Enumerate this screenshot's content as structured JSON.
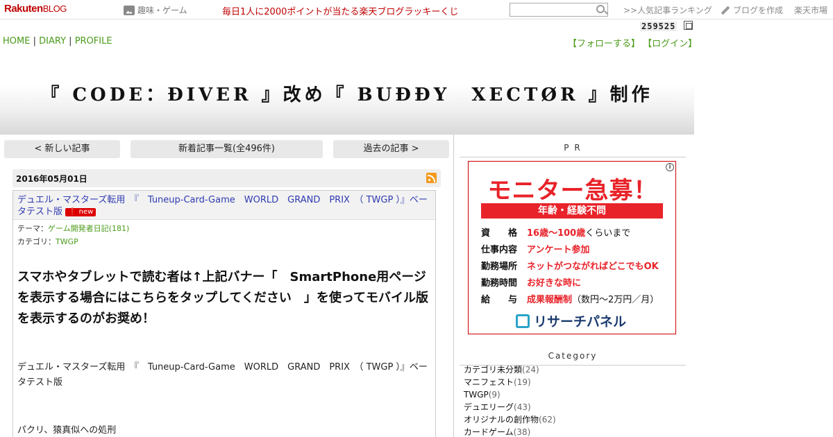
{
  "topbar": {
    "logo_main": "Rakuten",
    "logo_sub": "BLOG",
    "category": "趣味・ゲーム",
    "lottery": "毎日1人に2000ポイントが当たる楽天ブログラッキーくじ",
    "search_value": "",
    "ranking": ">>人気記事ランキング",
    "write": "ブログを作成",
    "market": "楽天市場"
  },
  "counter": "259525",
  "nav": {
    "home": "HOME",
    "diary": "DIARY",
    "profile": "PROFILE",
    "sep": "|",
    "follow": "【フォローする】",
    "login": "【ログイン】"
  },
  "banner": {
    "title": "『 CODE：ĐIVER 』改め『 BUĐĐY　XECTØR 』制作"
  },
  "pager": {
    "newer": "< 新しい記事",
    "list": "新着記事一覧(全496件)",
    "older": "過去の記事 >"
  },
  "post": {
    "date": "2016年05月01日",
    "title": "デュエル・マスターズ転用　『　Tuneup-Card-Game　WORLD　GRAND　PRIX　（ TWGP ）』ベータテスト版",
    "new_badge": "new",
    "theme_label": "テーマ：",
    "theme": "ゲーム開発者日記(181)",
    "category_label": "カテゴリ：",
    "category": "TWGP",
    "lead": "スマホやタブレットで読む者は↑上記バナー「　SmartPhone用ページを表示する場合にはこちらをタップしてください　」を使ってモバイル版を表示するのがお奨め！",
    "body1": "デュエル・マスターズ転用　『　Tuneup-Card-Game　WORLD　GRAND　PRIX　（ TWGP ）』ベータテスト版",
    "body2": "パクリ、猿真似への処刑"
  },
  "sidebar": {
    "pr_heading": "P R",
    "ad": {
      "headline": "モニター急募！",
      "bar": "年齢・経験不問",
      "rows": [
        {
          "label": "資　　格",
          "value": "16歳～100歳",
          "tail": "くらいまで"
        },
        {
          "label": "仕事内容",
          "value": "アンケート参加",
          "tail": ""
        },
        {
          "label": "勤務場所",
          "value": "ネットがつながればどこでもOK",
          "tail": ""
        },
        {
          "label": "勤務時間",
          "value": "お好きな時に",
          "tail": ""
        },
        {
          "label": "給　　与",
          "value": "成果報酬制",
          "tail": "（数円～2万円／月）"
        }
      ],
      "brand": "リサーチパネル"
    },
    "category_heading": "Category",
    "categories": [
      {
        "name": "カテゴリ未分類",
        "count": "(24)"
      },
      {
        "name": "マニフェスト",
        "count": "(19)"
      },
      {
        "name": "TWGP",
        "count": "(9)"
      },
      {
        "name": "デュエリーグ",
        "count": "(43)"
      },
      {
        "name": "オリジナルの創作物",
        "count": "(62)"
      },
      {
        "name": "カードゲーム",
        "count": "(38)"
      }
    ]
  }
}
